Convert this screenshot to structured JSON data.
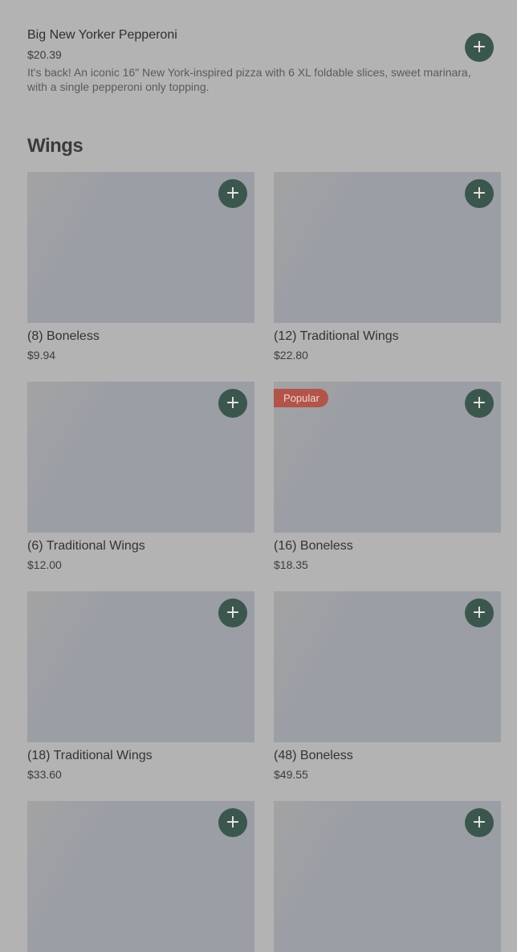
{
  "featured": {
    "title": "Big New Yorker Pepperoni",
    "price": "$20.39",
    "description": "It's back! An iconic 16\" New York-inspired pizza with 6 XL foldable slices, sweet marinara, with a single pepperoni only topping.",
    "add_icon": "plus-icon"
  },
  "section": {
    "title": "Wings"
  },
  "items": [
    {
      "name": "(8) Boneless",
      "price": "$9.94",
      "badge": ""
    },
    {
      "name": "(12) Traditional Wings",
      "price": "$22.80",
      "badge": ""
    },
    {
      "name": "(6) Traditional Wings",
      "price": "$12.00",
      "badge": ""
    },
    {
      "name": "(16) Boneless",
      "price": "$18.35",
      "badge": "Popular"
    },
    {
      "name": "(18) Traditional Wings",
      "price": "$33.60",
      "badge": ""
    },
    {
      "name": "(48) Boneless",
      "price": "$49.55",
      "badge": ""
    },
    {
      "name": "",
      "price": "",
      "badge": ""
    },
    {
      "name": "",
      "price": "",
      "badge": ""
    }
  ],
  "colors": {
    "overlay": "#b3b3b3",
    "add_button": "#3b574d",
    "badge": "#b3544a"
  },
  "add_glyph": "+"
}
